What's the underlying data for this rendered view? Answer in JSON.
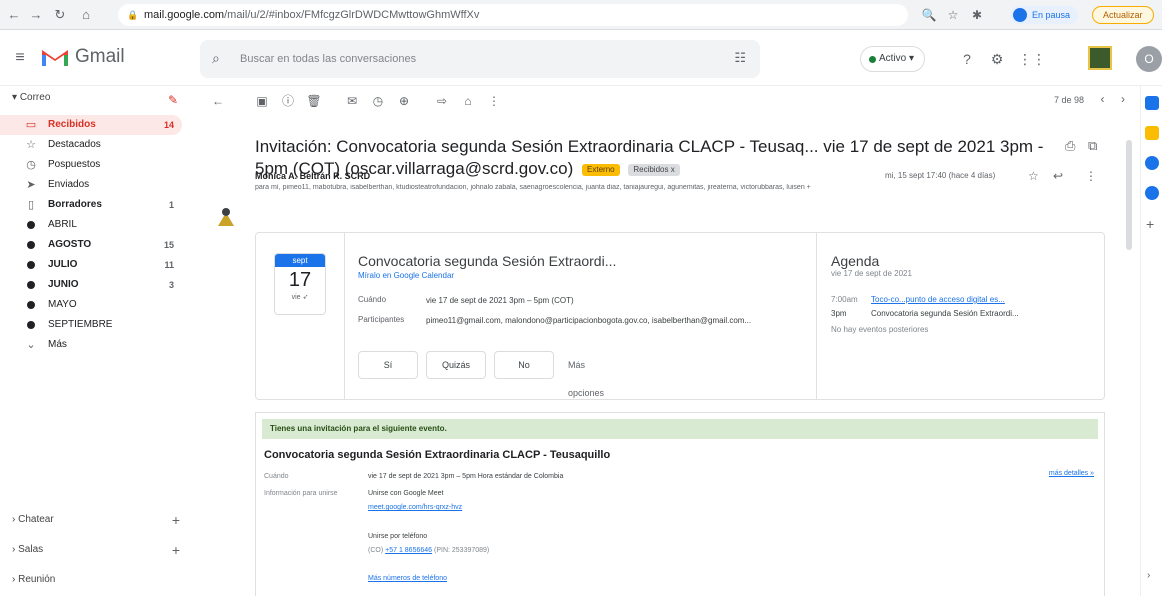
{
  "browser": {
    "url_host": "mail.google.com",
    "url_path": "/mail/u/2/#inbox/FMfcgzGlrDWDCMwttowGhmWffXv",
    "profile_label": "En pausa",
    "update_label": "Actualizar"
  },
  "header": {
    "app_name": "Gmail",
    "search_placeholder": "Buscar en todas las conversaciones",
    "status_label": "Activo"
  },
  "sidebar": {
    "mail_section": "Correo",
    "items": [
      {
        "label": "Recibidos",
        "count": "14"
      },
      {
        "label": "Destacados",
        "count": ""
      },
      {
        "label": "Pospuestos",
        "count": ""
      },
      {
        "label": "Enviados",
        "count": ""
      },
      {
        "label": "Borradores",
        "count": "1"
      },
      {
        "label": "ABRIL",
        "count": ""
      },
      {
        "label": "AGOSTO",
        "count": "15"
      },
      {
        "label": "JULIO",
        "count": "11"
      },
      {
        "label": "JUNIO",
        "count": "3"
      },
      {
        "label": "MAYO",
        "count": ""
      },
      {
        "label": "SEPTIEMBRE",
        "count": ""
      },
      {
        "label": "Más",
        "count": ""
      }
    ],
    "chat_section": "Chatear",
    "rooms_section": "Salas",
    "meeting_section": "Reunión"
  },
  "toolbar": {
    "pager_text": "7 de 98"
  },
  "email": {
    "subject": "Invitación: Convocatoria segunda Sesión Extraordinaria CLACP - Teusaq... vie 17 de sept de 2021 3pm - 5pm (COT) (oscar.villarraga@scrd.gov.co)",
    "chip_external": "Externo",
    "chip_inbox": "Recibidos x",
    "sender": "Mónica A. Beltrán R. SCRD",
    "recipients": "para mí, pimeo11, mabotubra, isabelberthan, ktudiosteatrofundacion, johnalo zabala, saenagroescolencia, juanta diaz, taniajauregui, agunemitas, jireaterna, victorubbaras, luisen +",
    "date": "mi, 15 sept 17:40 (hace 4 días)"
  },
  "calendar_card": {
    "month": "sept",
    "day": "17",
    "dow": "vie",
    "event_title": "Convocatoria segunda Sesión Extraordi...",
    "gcal_link": "Míralo en Google Calendar",
    "when_label": "Cuándo",
    "when_value": "vie 17 de sept de 2021 3pm – 5pm (COT)",
    "participants_label": "Participantes",
    "participants_value": "pimeo11@gmail.com, malondono@participacionbogota.gov.co, isabelberthan@gmail.com...",
    "rsvp_yes": "Sí",
    "rsvp_maybe": "Quizás",
    "rsvp_no": "No",
    "rsvp_more": "Más opciones",
    "agenda_title": "Agenda",
    "agenda_date": "vie 17 de sept de 2021",
    "agenda_row1_time": "7:00am",
    "agenda_row1_text": "Toco-co...punto de acceso digital es...",
    "agenda_row2_time": "3pm",
    "agenda_row2_text": "Convocatoria segunda Sesión Extraordi...",
    "agenda_row3_text": "No hay eventos posteriores"
  },
  "invitation": {
    "banner": "Tienes una invitación para el siguiente evento.",
    "title": "Convocatoria segunda Sesión Extraordinaria CLACP - Teusaquillo",
    "when_label": "Cuándo",
    "when_value": "vie 17 de sept de 2021 3pm – 5pm Hora estándar de Colombia",
    "more_details": "más detalles »",
    "join_label": "Información para unirse",
    "meet_label": "Unirse con Google Meet",
    "meet_link": "meet.google.com/hrs-qrxz-hvz",
    "phone_label": "Unirse por teléfono",
    "phone_prefix": "(CO)",
    "phone_number": "+57 1 8656646",
    "phone_pin": "(PIN: 253397089)",
    "more_numbers": "Más números de teléfono"
  },
  "colors": {
    "gmail_red": "#d93025",
    "link_blue": "#1a73e8",
    "banner_green": "#d9ead3",
    "external_chip": "#fbbc04"
  }
}
